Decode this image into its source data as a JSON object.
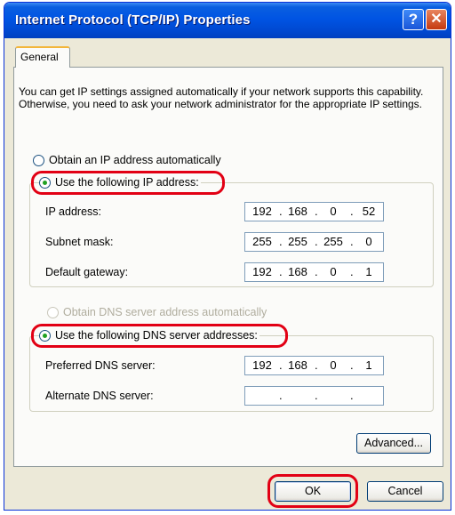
{
  "window": {
    "title": "Internet Protocol (TCP/IP) Properties",
    "help_glyph": "?",
    "close_glyph": "✕"
  },
  "tabs": [
    {
      "label": "General"
    }
  ],
  "intro_text": "You can get IP settings assigned automatically if your network supports this capability. Otherwise, you need to ask your network administrator for the appropriate IP settings.",
  "ip_section": {
    "obtain_auto_label": "Obtain an IP address automatically",
    "use_following_label": "Use the following IP address:",
    "selected": "use_following",
    "fields": [
      {
        "label": "IP address:",
        "octets": [
          "192",
          "168",
          "0",
          "52"
        ]
      },
      {
        "label": "Subnet mask:",
        "octets": [
          "255",
          "255",
          "255",
          "0"
        ]
      },
      {
        "label": "Default gateway:",
        "octets": [
          "192",
          "168",
          "0",
          "1"
        ]
      }
    ]
  },
  "dns_section": {
    "obtain_auto_label": "Obtain DNS server address automatically",
    "use_following_label": "Use the following DNS server addresses:",
    "selected": "use_following",
    "fields": [
      {
        "label": "Preferred DNS server:",
        "octets": [
          "192",
          "168",
          "0",
          "1"
        ]
      },
      {
        "label": "Alternate DNS server:",
        "octets": [
          "",
          "",
          "",
          ""
        ]
      }
    ]
  },
  "buttons": {
    "advanced": "Advanced...",
    "ok": "OK",
    "cancel": "Cancel"
  },
  "colors": {
    "titlebar": "#0054e3",
    "dialog_bg": "#ece9d8",
    "highlight": "#e20014",
    "radio_dot": "#21a121"
  }
}
